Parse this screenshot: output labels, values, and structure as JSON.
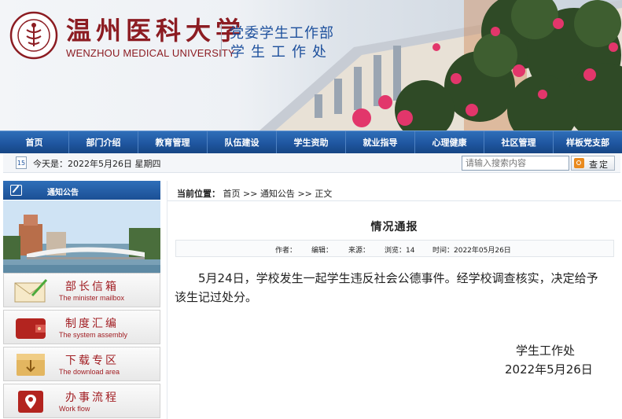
{
  "header": {
    "school_cn": "温州医科大学",
    "school_en": "WENZHOU MEDICAL UNIVERSITY",
    "dept_line1": "党委学生工作部",
    "dept_line2": "学生工作处"
  },
  "nav": {
    "items": [
      "首页",
      "部门介绍",
      "教育管理",
      "队伍建设",
      "学生资助",
      "就业指导",
      "心理健康",
      "社区管理",
      "样板党支部"
    ]
  },
  "infobar": {
    "calendar_day": "15",
    "date_text": "今天是：2022年5月26日 星期四",
    "search_placeholder": "请输入搜索内容",
    "search_button": "查定"
  },
  "sidebar": {
    "notice_title": "通知公告",
    "services": [
      {
        "title": "部长信箱",
        "subtitle": "The minister mailbox",
        "icon": "envelope-icon"
      },
      {
        "title": "制度汇编",
        "subtitle": "The system assembly",
        "icon": "wallet-icon"
      },
      {
        "title": "下载专区",
        "subtitle": "The download area",
        "icon": "download-box-icon"
      },
      {
        "title": "办事流程",
        "subtitle": "Work flow",
        "icon": "location-pin-icon"
      }
    ]
  },
  "breadcrumb": {
    "prefix": "当前位置：",
    "items": [
      "首页",
      "通知公告",
      "正文"
    ],
    "separator": ">>"
  },
  "article": {
    "title": "情况通报",
    "meta": {
      "author": "作者：",
      "editor": "编辑：",
      "source": "来源：",
      "views": "浏览：14",
      "time": "时间：2022年05月26日"
    },
    "body": "5月24日，学校发生一起学生违反社会公德事件。经学校调查核实，决定给予该生记过处分。",
    "sign_dept": "学生工作处",
    "sign_date": "2022年5月26日"
  },
  "colors": {
    "nav_blue": "#1f56a0",
    "brand_red": "#8c1c22",
    "dept_blue": "#1c4f9c",
    "search_orange": "#e98a1e"
  }
}
